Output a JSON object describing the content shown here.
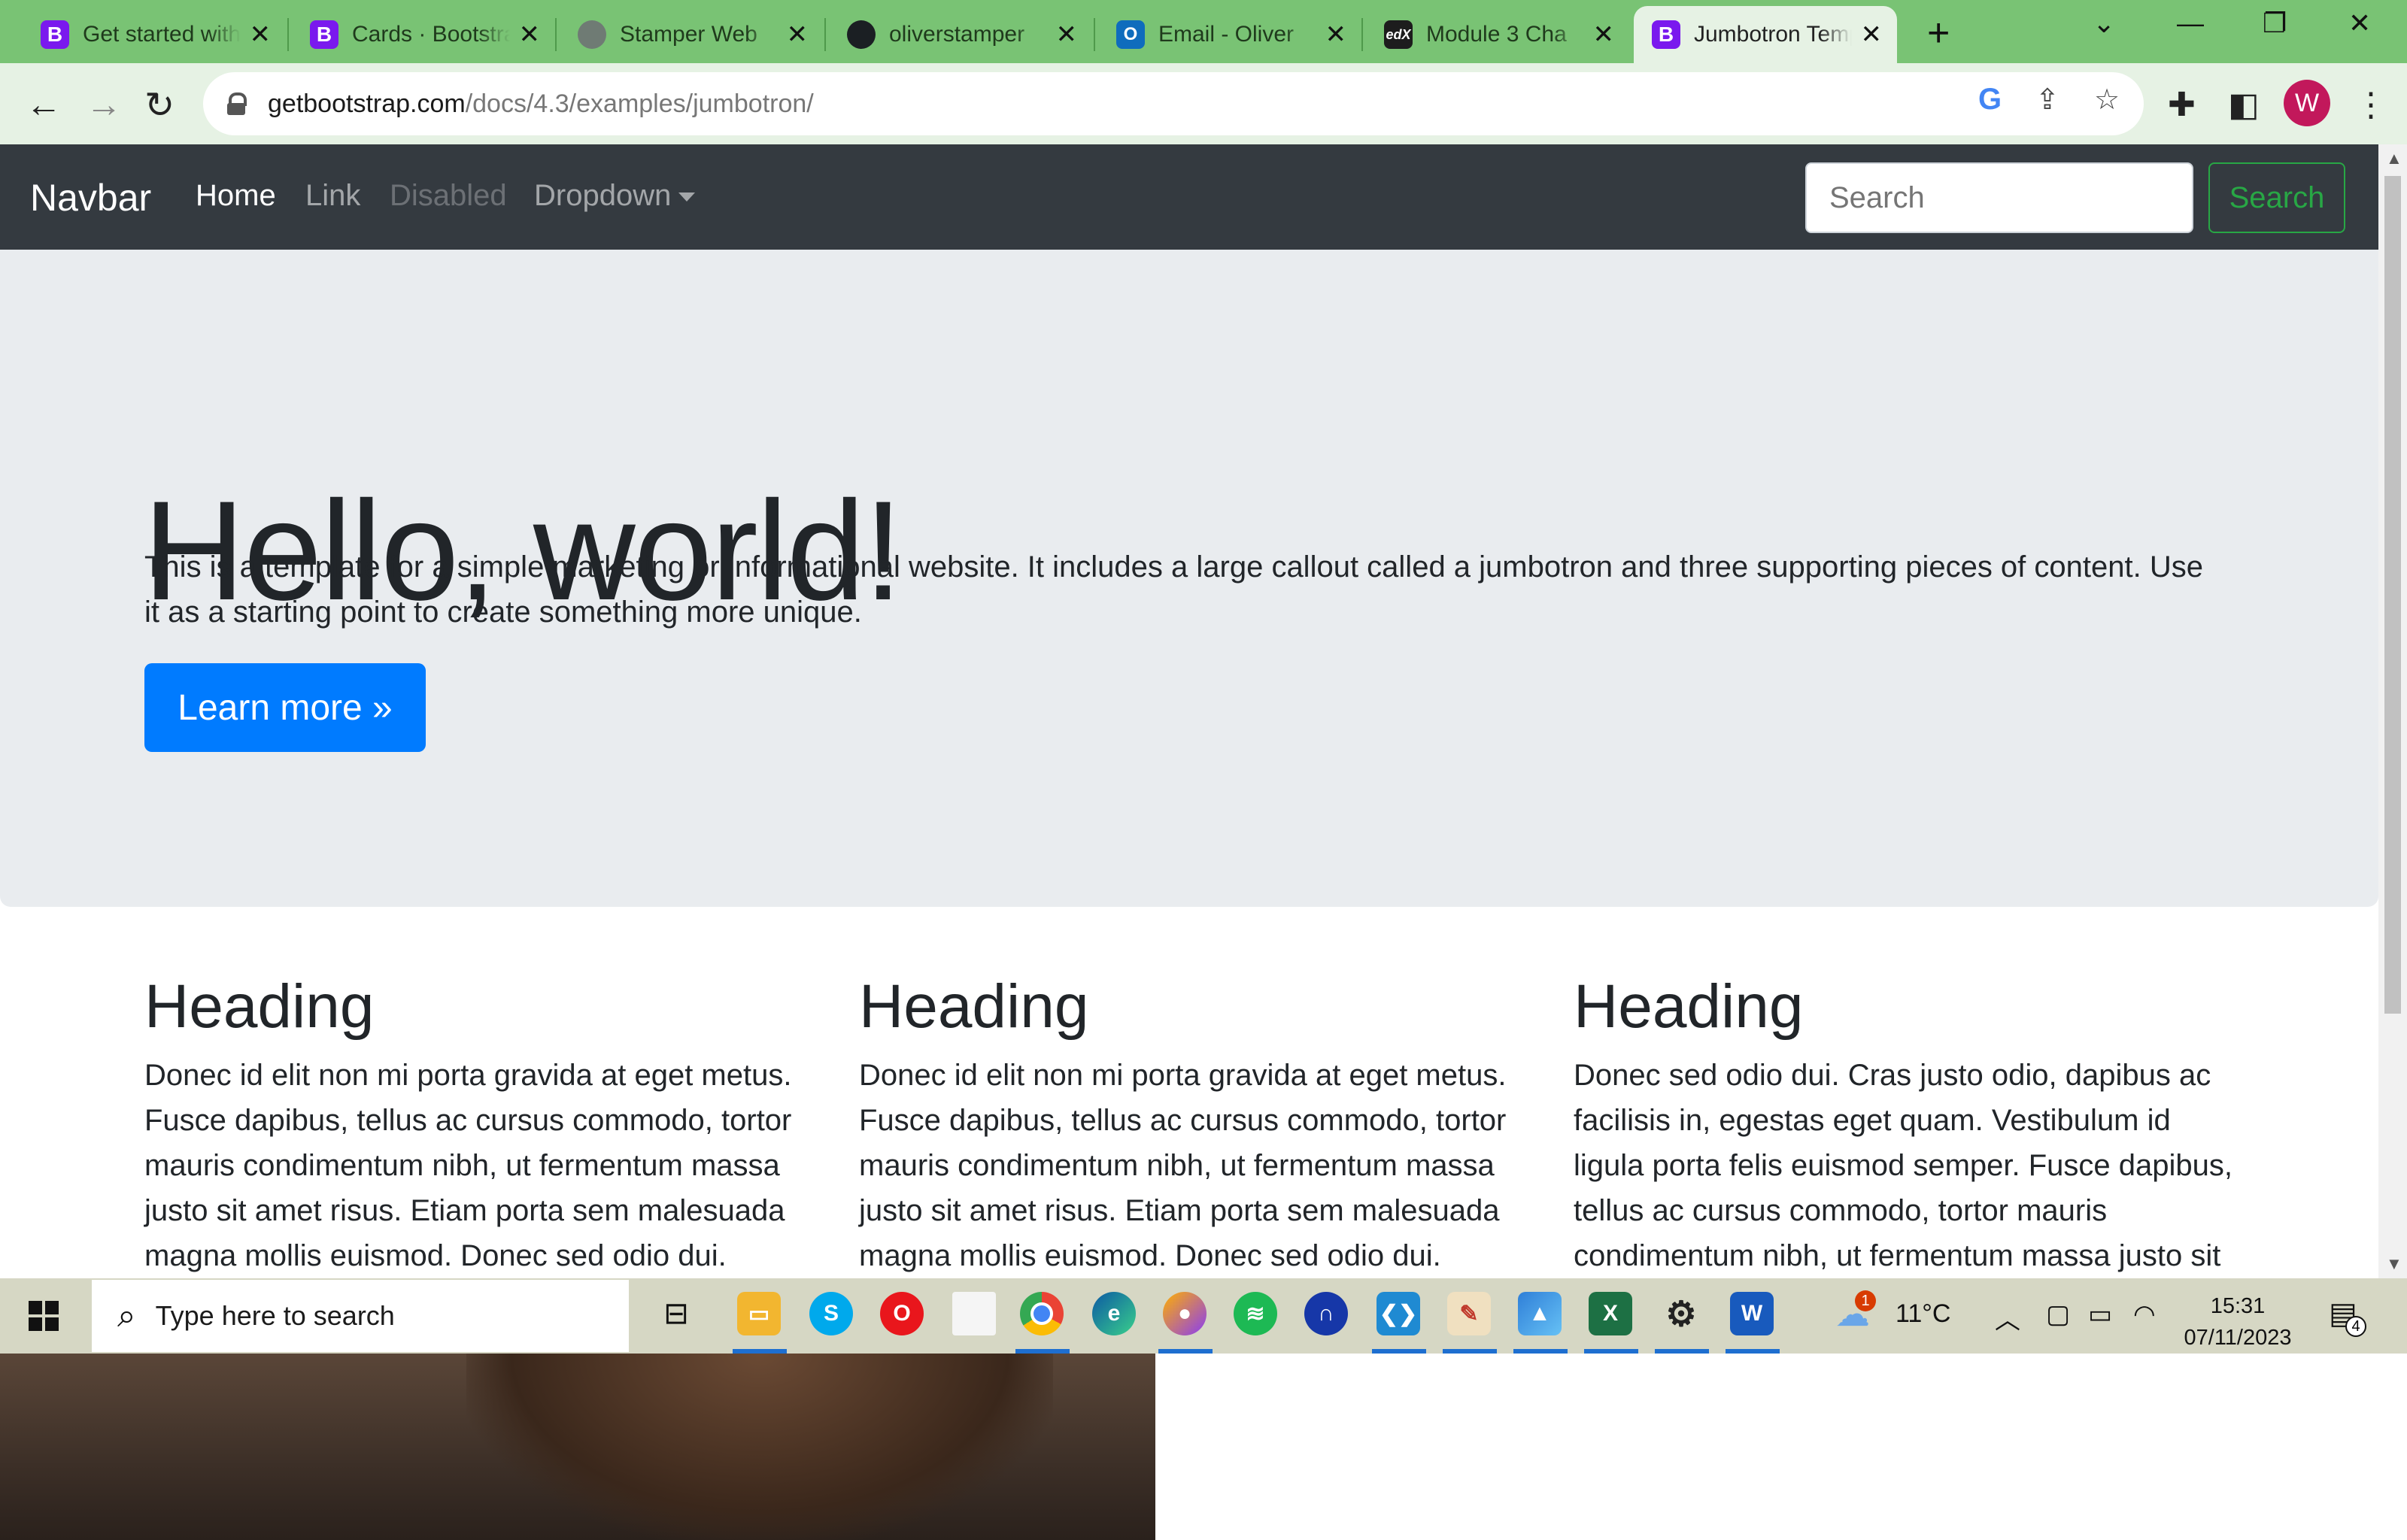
{
  "browser": {
    "tabs": [
      {
        "title": "Get started with Bootstrap",
        "favicon": "bootstrap-icon",
        "active": false
      },
      {
        "title": "Cards · Bootstrap",
        "favicon": "bootstrap-icon",
        "active": false
      },
      {
        "title": "Stamper Web",
        "favicon": "globe-icon",
        "active": false
      },
      {
        "title": "oliverstamper",
        "favicon": "github-icon",
        "active": false
      },
      {
        "title": "Email - Oliver",
        "favicon": "outlook-icon",
        "active": false
      },
      {
        "title": "Module 3 Cha",
        "favicon": "edx-icon",
        "active": false
      },
      {
        "title": "Jumbotron Template",
        "favicon": "bootstrap-icon",
        "active": true
      }
    ],
    "address": {
      "domain": "getbootstrap.com",
      "path": "/docs/4.3/examples/jumbotron/"
    },
    "profile_initial": "W",
    "theme_color": "#79c374"
  },
  "page": {
    "navbar": {
      "brand": "Navbar",
      "links": [
        {
          "label": "Home",
          "state": "active"
        },
        {
          "label": "Link",
          "state": "normal"
        },
        {
          "label": "Disabled",
          "state": "disabled"
        },
        {
          "label": "Dropdown",
          "state": "dropdown"
        }
      ],
      "search_placeholder": "Search",
      "search_button": "Search"
    },
    "jumbotron": {
      "title": "Hello, world!",
      "lead": "This is a template for a simple marketing or informational website. It includes a large callout called a jumbotron and three supporting pieces of content. Use it as a starting point to create something more unique.",
      "button": "Learn more »",
      "button_color": "#007bff"
    },
    "columns": [
      {
        "heading": "Heading",
        "text": "Donec id elit non mi porta gravida at eget metus. Fusce dapibus, tellus ac cursus commodo, tortor mauris condimentum nibh, ut fermentum massa justo sit amet risus. Etiam porta sem malesuada magna mollis euismod. Donec sed odio dui."
      },
      {
        "heading": "Heading",
        "text": "Donec id elit non mi porta gravida at eget metus. Fusce dapibus, tellus ac cursus commodo, tortor mauris condimentum nibh, ut fermentum massa justo sit amet risus. Etiam porta sem malesuada magna mollis euismod. Donec sed odio dui."
      },
      {
        "heading": "Heading",
        "text": "Donec sed odio dui. Cras justo odio, dapibus ac facilisis in, egestas eget quam. Vestibulum id ligula porta felis euismod semper. Fusce dapibus, tellus ac cursus commodo, tortor mauris condimentum nibh, ut fermentum massa justo sit"
      }
    ]
  },
  "taskbar": {
    "search_placeholder": "Type here to search",
    "apps": [
      "task-view-icon",
      "file-explorer-icon",
      "skype-icon",
      "opera-icon",
      "notepad-icon",
      "chrome-icon",
      "edge-icon",
      "vpn-icon",
      "spotify-icon",
      "audacity-icon",
      "vscode-icon",
      "paint-icon",
      "photos-icon",
      "excel-icon",
      "settings-icon",
      "word-icon"
    ],
    "weather": {
      "temp": "11°C",
      "alert_count": "1"
    },
    "clock": {
      "time": "15:31",
      "date": "07/11/2023"
    },
    "notifications": "4"
  }
}
